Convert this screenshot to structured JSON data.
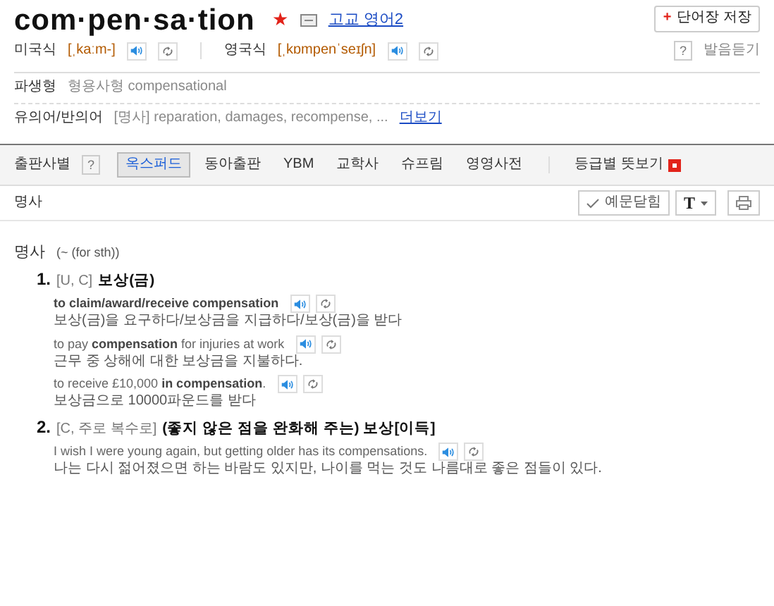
{
  "headword": "com·pen·sa·tion",
  "star": "★",
  "level_link": "고교 영어2",
  "save_plus": "+",
  "save_button": "단어장 저장",
  "pronunciations": [
    {
      "label": "미국식",
      "ipa": "[ˌkaːm-]"
    },
    {
      "label": "영국식",
      "ipa": "[ˌkɒmpenˈseɪʃn]"
    }
  ],
  "pron_help": "?",
  "pron_listen": "발음듣기",
  "derived": {
    "label": "파생형",
    "text": "형용사형 compensational"
  },
  "synonyms": {
    "label": "유의어/반의어",
    "text": "[명사] reparation, damages, recompense, ...",
    "more": "더보기"
  },
  "publisher_bar": {
    "label": "출판사별",
    "help": "?",
    "tabs": [
      {
        "label": "옥스퍼드",
        "selected": true
      },
      {
        "label": "동아출판",
        "selected": false
      },
      {
        "label": "YBM",
        "selected": false
      },
      {
        "label": "교학사",
        "selected": false
      },
      {
        "label": "슈프림",
        "selected": false
      },
      {
        "label": "영영사전",
        "selected": false
      }
    ],
    "grade_view": "등급별 뜻보기"
  },
  "toolbar": {
    "pos": "명사",
    "example_toggle": "예문닫힘",
    "font_button": "T"
  },
  "entry": {
    "pos": "명사",
    "pattern": "(~ (for sth))",
    "senses": [
      {
        "number": "1.",
        "grammar": "[U, C]",
        "meaning": "보상(금)",
        "examples": [
          {
            "en": "**to claim/award/receive compensation**",
            "ko": "보상(금)을 요구하다/보상금을 지급하다/보상(금)을 받다"
          },
          {
            "en": "to pay **compensation** for injuries at work",
            "ko": "근무 중 상해에 대한 보상금을 지불하다."
          },
          {
            "en": "to receive £10,000 **in compensation**.",
            "ko": "보상금으로 10000파운드를 받다"
          }
        ]
      },
      {
        "number": "2.",
        "grammar": "[C, 주로 복수로]",
        "meaning": "(좋지 않은 점을 완화해 주는) 보상[이득]",
        "examples": [
          {
            "en": "I wish I were young again, but getting older has its compensations.",
            "ko": "나는 다시 젊어졌으면 하는 바람도 있지만, 나이를 먹는 것도 나름대로 좋은 점들이 있다."
          }
        ]
      }
    ]
  }
}
